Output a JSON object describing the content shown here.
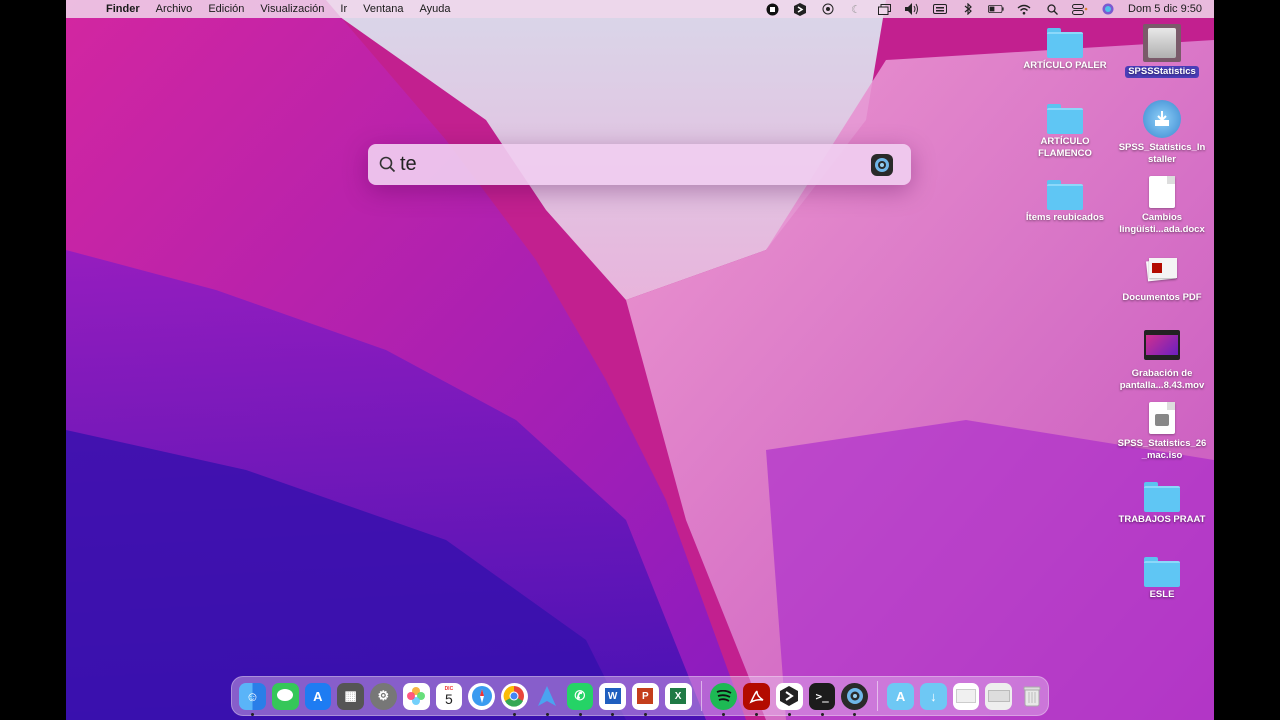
{
  "menubar": {
    "app_name": "Finder",
    "items": [
      "Archivo",
      "Edición",
      "Visualización",
      "Ir",
      "Ventana",
      "Ayuda"
    ],
    "clock": "Dom 5 dic  9:50"
  },
  "spotlight": {
    "query": "te"
  },
  "desktop": {
    "icons": [
      {
        "label": "ARTÍCULO PALER",
        "type": "folder"
      },
      {
        "label": "SPSSStatistics",
        "type": "drive"
      },
      {
        "label": "ARTÍCULO FLAMENCO",
        "type": "folder"
      },
      {
        "label": "SPSS_Statistics_Installer",
        "type": "installer"
      },
      {
        "label": "Ítems reubicados",
        "type": "folder"
      },
      {
        "label": "Cambios lingüísti...ada.docx",
        "type": "document"
      },
      {
        "label": "Documentos PDF",
        "type": "pdf-stack"
      },
      {
        "label": "Grabación de pantalla...8.43.mov",
        "type": "video"
      },
      {
        "label": "SPSS_Statistics_26_mac.iso",
        "type": "disk-image"
      },
      {
        "label": "TRABAJOS PRAAT",
        "type": "folder"
      },
      {
        "label": "ESLE",
        "type": "folder"
      }
    ]
  },
  "dock": {
    "calendar_month": "DIC",
    "calendar_day": "5",
    "colors": {
      "finder": "#3b8ff0",
      "messages": "#35c759",
      "appstore": "#1e7cf2",
      "spotify": "#1db954",
      "acrobat": "#b30b00",
      "word": "#1f5fbf",
      "powerpoint": "#c43e1c",
      "excel": "#1f7a45"
    }
  }
}
